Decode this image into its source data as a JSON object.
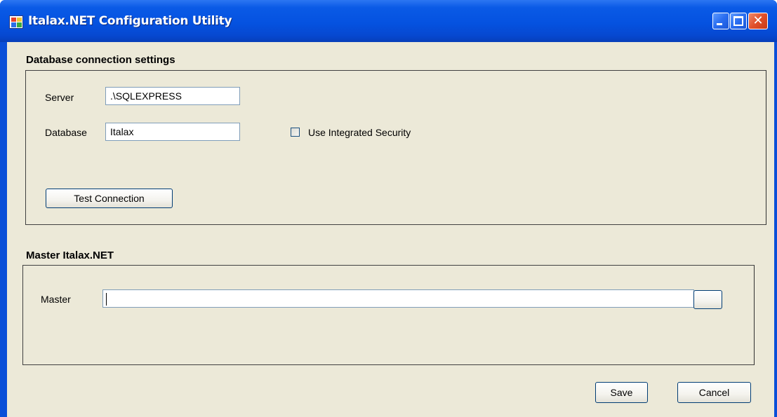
{
  "window": {
    "title": "Italax.NET Configuration Utility"
  },
  "database_section": {
    "title": "Database connection settings",
    "server_label": "Server",
    "server_value": ".\\SQLEXPRESS",
    "database_label": "Database",
    "database_value": "Italax",
    "integrated_security_label": "Use Integrated Security",
    "integrated_security_checked": false,
    "test_connection_label": "Test Connection"
  },
  "master_section": {
    "title": "Master Italax.NET",
    "master_label": "Master",
    "master_value": "",
    "browse_label": ""
  },
  "footer": {
    "save_label": "Save",
    "cancel_label": "Cancel"
  },
  "colors": {
    "titlebar": "#0552e0",
    "client_background": "#ece9d8",
    "textbox_border": "#7f9db9",
    "button_border": "#003c74"
  }
}
